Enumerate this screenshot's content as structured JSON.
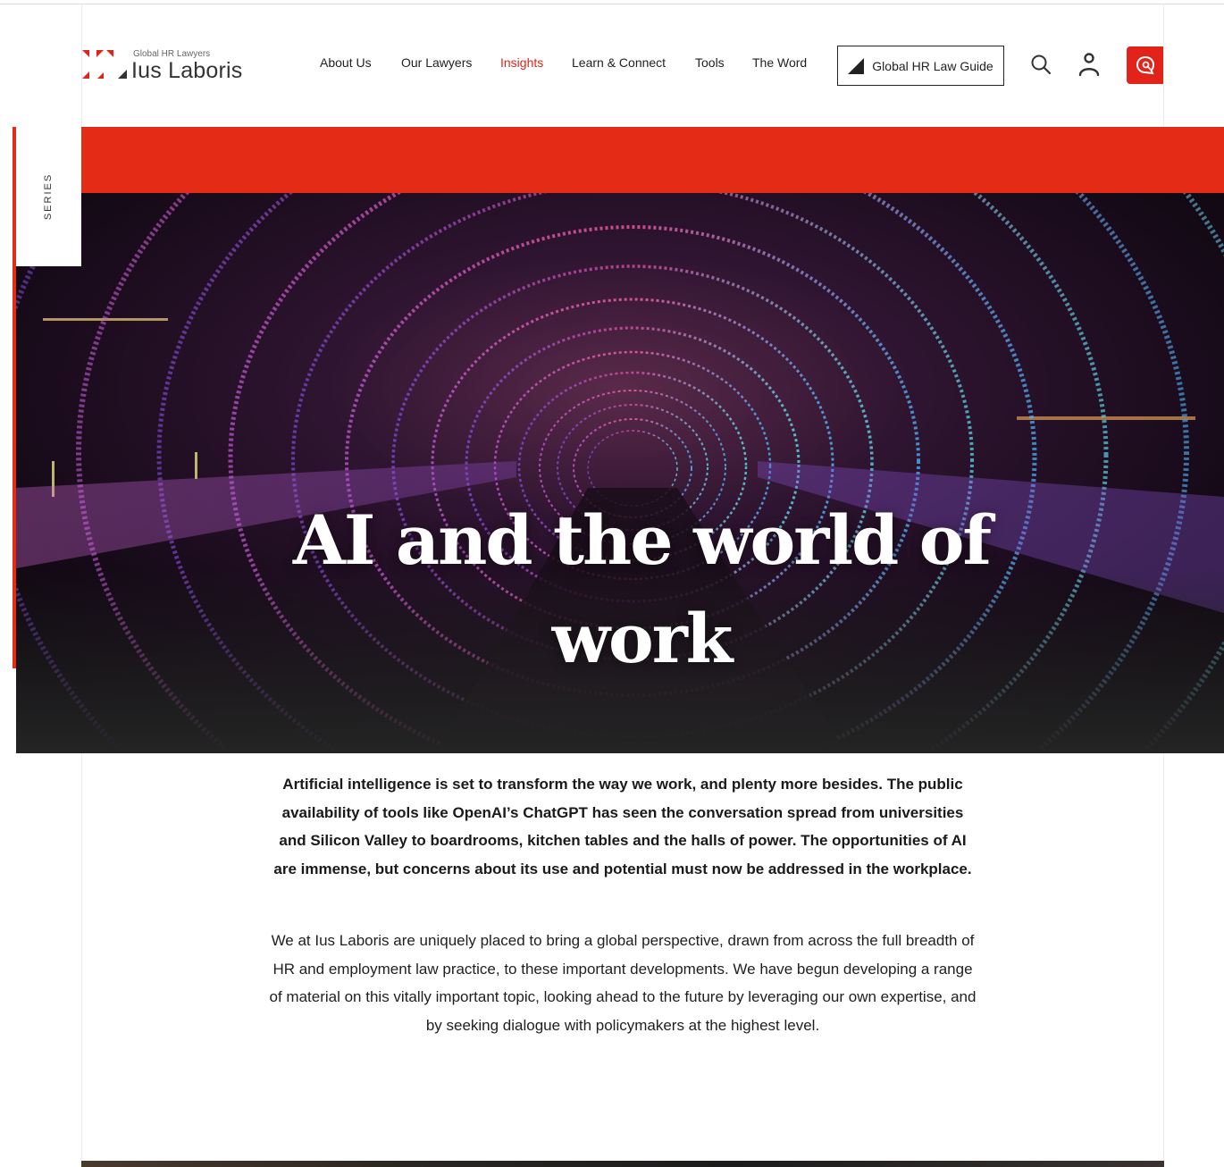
{
  "brand": {
    "tagline": "Global HR Lawyers",
    "name": "Ius Laboris",
    "accent_color": "#e2231a"
  },
  "nav": {
    "items": [
      {
        "label": "About Us",
        "active": false
      },
      {
        "label": "Our Lawyers",
        "active": false
      },
      {
        "label": "Insights",
        "active": true
      },
      {
        "label": "Learn & Connect",
        "active": false
      },
      {
        "label": "Tools",
        "active": false
      },
      {
        "label": "The Word",
        "active": false
      }
    ],
    "guide_button": {
      "label": "Global HR Law Guide",
      "icon": "triangle-flag-icon"
    },
    "icons": [
      "search-icon",
      "user-icon",
      "chat-support-icon"
    ]
  },
  "hero": {
    "series_label": "SERIES",
    "title": "AI and the world of work",
    "band_color": "#e32b16",
    "image": "neon-light-tunnel"
  },
  "content": {
    "intro": "Artificial intelligence is set to transform the way we work, and plenty more besides. The public availability of tools like OpenAI’s ChatGPT has seen the conversation spread from universities and Silicon Valley to boardrooms, kitchen tables and the halls of power. The opportunities of AI are immense, but concerns about its use and potential must now be addressed in the workplace.",
    "body": "We at Ius Laboris are uniquely placed to bring a global perspective, drawn from across the full breadth of HR and employment law practice, to these important developments. We have begun developing a range of material on this vitally important topic, looking ahead to the future by leveraging our own expertise, and by seeking dialogue with policymakers at the highest level."
  }
}
